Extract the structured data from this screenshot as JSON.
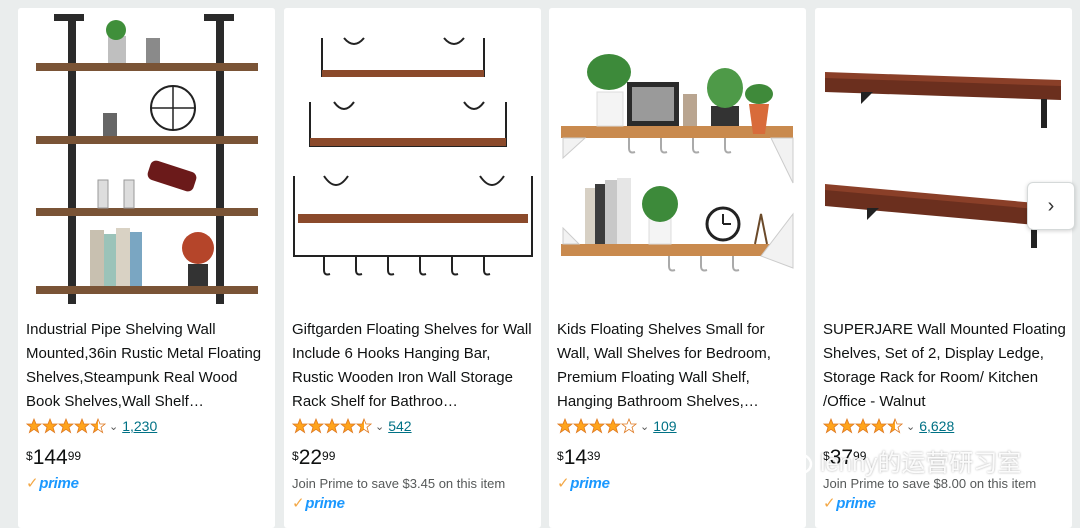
{
  "products": [
    {
      "title": "Industrial Pipe Shelving Wall Mounted,36in Rustic Metal Floating Shelves,Steampunk Real Wood Book Shelves,Wall Shelf…",
      "rating": 4.5,
      "reviews": "1,230",
      "price_symbol": "$",
      "price_whole": "144",
      "price_fraction": "99",
      "prime_save": "",
      "prime": true
    },
    {
      "title": "Giftgarden Floating Shelves for Wall Include 6 Hooks Hanging Bar, Rustic Wooden Iron Wall Storage Rack Shelf for Bathroo…",
      "rating": 4.5,
      "reviews": "542",
      "price_symbol": "$",
      "price_whole": "22",
      "price_fraction": "99",
      "prime_save": "Join Prime to save $3.45 on this item",
      "prime": true
    },
    {
      "title": "Kids Floating Shelves Small for Wall, Wall Shelves for Bedroom, Premium Floating Wall Shelf, Hanging Bathroom Shelves,…",
      "rating": 4.0,
      "reviews": "109",
      "price_symbol": "$",
      "price_whole": "14",
      "price_fraction": "39",
      "prime_save": "",
      "prime": true
    },
    {
      "title": "SUPERJARE Wall Mounted Floating Shelves, Set of 2, Display Ledge, Storage Rack for Room/ Kitchen /Office - Walnut",
      "rating": 4.5,
      "reviews": "6,628",
      "price_symbol": "$",
      "price_whole": "37",
      "price_fraction": "99",
      "prime_save": "Join Prime to save $8.00 on this item",
      "prime": true
    }
  ],
  "prime_label": "prime",
  "prime_check": "✓",
  "next_arrow": "›",
  "watermark_text": "lenny的运营研习室",
  "colors": {
    "star": "#ffa41c",
    "link": "#007185",
    "prime_blue": "#1a98ff",
    "wood": "#8b4a2b",
    "walnut": "#6b2f1e"
  }
}
